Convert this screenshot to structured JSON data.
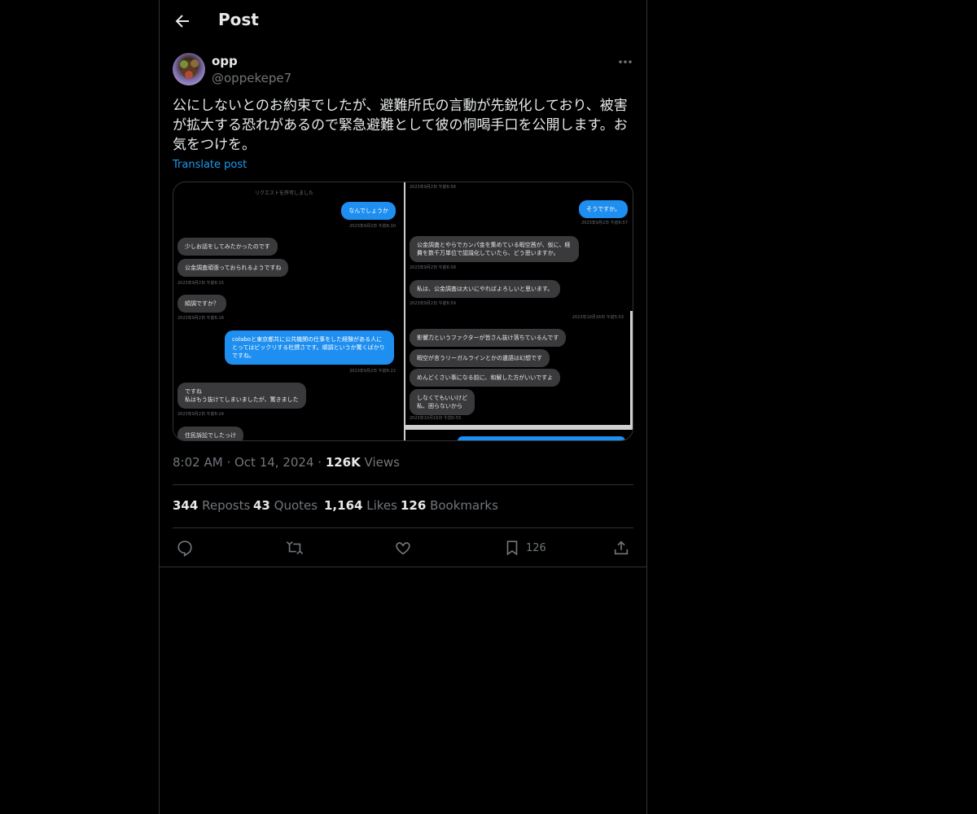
{
  "header": {
    "title": "Post"
  },
  "author": {
    "name": "opp",
    "handle": "@oppekepe7"
  },
  "post": {
    "text": "公にしないとのお約束でしたが、避難所氏の言動が先鋭化しており、被害が拡大する恐れがあるので緊急避難として彼の恫喝手口を公開します。お気をつけを。",
    "translate_label": "Translate post",
    "time": "8:02 AM",
    "date": "Oct 14, 2024",
    "views_count": "126K",
    "views_label": "Views"
  },
  "screenshot": {
    "left": {
      "system": "リクエストを許可しました",
      "msgs": [
        {
          "type": "out",
          "text": "なんでしょうか",
          "ts": "2023年9月2日 午前6:10"
        },
        {
          "type": "in",
          "text": "少しお話をしてみたかったのです",
          "ts": ""
        },
        {
          "type": "in",
          "text": "公金調査頑張っておられるようですね",
          "ts": "2023年9月2日 午前6:15"
        },
        {
          "type": "in",
          "text": "順調ですか？",
          "ts": "2023年9月2日 午前6:16"
        },
        {
          "type": "out",
          "text": "colaboと東京都共に公共機関の仕事をした経験がある人にとってはビックリする杜撰さです。順調というか驚くばかりですね。",
          "ts": "2023年9月2日 午前6:22"
        },
        {
          "type": "in",
          "text": "ですね\n私はもう抜けてしまいましたが、驚きました",
          "ts": "2023年9月2日 午前6:24"
        },
        {
          "type": "in",
          "text": "住民訴訟でしたっけ",
          "ts": ""
        }
      ]
    },
    "right_top": {
      "msgs": [
        {
          "type": "ts",
          "text": "2023年9月2日 午前6:56"
        },
        {
          "type": "out",
          "text": "そうですか。",
          "ts": "2023年9月2日 午前6:57"
        },
        {
          "type": "in",
          "text": "公金調査とやらでカンパ金を集めている暇空茜が、仮に、経費を数千万単位で認識化していたら、どう思いますか。",
          "ts": "2023年9月2日 午前6:58"
        },
        {
          "type": "in",
          "text": "私は、公金調査は大いにやればよろしいと思います。",
          "ts": "2023年9月2日 午前6:59"
        }
      ]
    },
    "right_mid": {
      "msgs": [
        {
          "type": "ts",
          "text": "2023年10月16日 午前5:53"
        },
        {
          "type": "in",
          "text": "影響力というファクターが皆さん抜け落ちているんです",
          "ts": ""
        },
        {
          "type": "in",
          "text": "暇空が言うリーガルラインとかの遺語は幻想です",
          "ts": ""
        },
        {
          "type": "in",
          "text": "めんどくさい事になる前に、和解した方がいいですよ",
          "ts": ""
        },
        {
          "type": "in",
          "text": "しなくてもいいけど\n私、困らないから",
          "ts": "2023年10月16日 午前5:55"
        }
      ]
    }
  },
  "stats": [
    {
      "count": "344",
      "label": "Reposts"
    },
    {
      "count": "43",
      "label": "Quotes"
    },
    {
      "count": "1,164",
      "label": "Likes"
    },
    {
      "count": "126",
      "label": "Bookmarks"
    }
  ],
  "actions": {
    "reply": {
      "icon": "reply-icon"
    },
    "repost": {
      "icon": "repost-icon"
    },
    "like": {
      "icon": "heart-icon"
    },
    "bookmark": {
      "icon": "bookmark-icon",
      "count": "126"
    },
    "share": {
      "icon": "share-icon"
    }
  },
  "colors": {
    "accent": "#1d9bf0",
    "background": "#000000",
    "text": "#e7e9ea",
    "muted": "#71767b",
    "border": "#2f3336"
  }
}
